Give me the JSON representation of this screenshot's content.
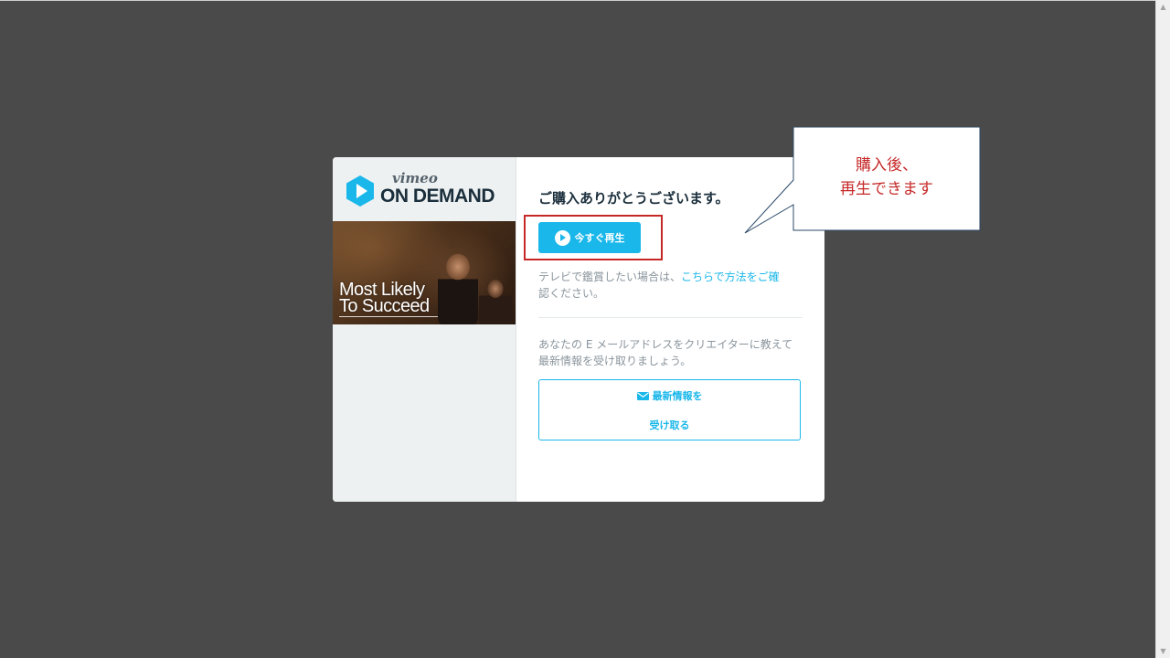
{
  "modal": {
    "logo_vimeo": "vimeo",
    "logo_on_demand": "ON DEMAND",
    "poster_title_line1": "Most Likely",
    "poster_title_line2": "To Succeed",
    "heading": "ご購入ありがとうございます。",
    "play_label": "今すぐ再生",
    "tv_text_prefix": "テレビで鑑賞したい場合は、",
    "tv_link": "こちらで方法をご確",
    "tv_text_suffix": "認ください。",
    "email_text": "あなたの E メールアドレスをクリエイターに教えて最新情報を受け取りましょう。",
    "subscribe_line1": "最新情報を",
    "subscribe_line2": "受け取る"
  },
  "annotation": {
    "callout_line1": "購入後、",
    "callout_line2": "再生できます"
  },
  "colors": {
    "background": "#4a4a4a",
    "accent": "#1ab7ea",
    "heading": "#1a2e3b",
    "muted_text": "#8a959d",
    "annotation_red": "#c62828"
  },
  "icons": {
    "logo": "vimeo-play-hexagon-icon",
    "play": "play-circle-icon",
    "mail": "envelope-icon"
  }
}
